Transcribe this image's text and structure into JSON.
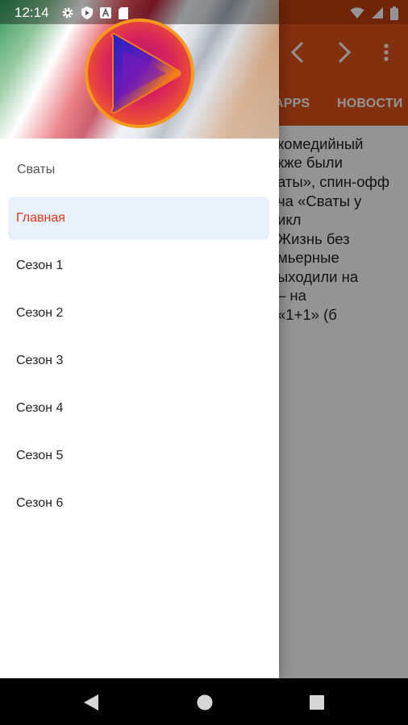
{
  "status_bar": {
    "time": "12:14",
    "left_icons": [
      "gear-icon",
      "shield-icon",
      "a-badge-icon",
      "sd-card-icon"
    ],
    "right_icons": [
      "wifi-icon",
      "signal-icon",
      "battery-icon"
    ]
  },
  "app_toolbar": {
    "back_icon": "chevron-left-icon",
    "forward_icon": "chevron-right-icon",
    "menu_icon": "more-vert-icon"
  },
  "app_tabs": [
    "APPS",
    "НОВОСТИ"
  ],
  "article_lines": [
    "комедийный",
    "кже были",
    "аты», спин-офф",
    "ча «Сваты у",
    "икл",
    "Жизнь без",
    "мьерные",
    "ыходили на",
    "– на",
    "«1+1» (б"
  ],
  "drawer": {
    "subtitle": "Сваты",
    "items": [
      {
        "label": "Главная",
        "active": true
      },
      {
        "label": "Сезон 1",
        "active": false
      },
      {
        "label": "Сезон 2",
        "active": false
      },
      {
        "label": "Сезон 3",
        "active": false
      },
      {
        "label": "Сезон 4",
        "active": false
      },
      {
        "label": "Сезон 5",
        "active": false
      },
      {
        "label": "Сезон 6",
        "active": false
      }
    ]
  },
  "nav_bar": {
    "back_icon": "triangle-back-icon",
    "home_icon": "circle-home-icon",
    "recent_icon": "square-recents-icon"
  },
  "colors": {
    "accent": "#e2541a",
    "active_text": "#e2361a",
    "active_bg": "#e7f1fc"
  }
}
